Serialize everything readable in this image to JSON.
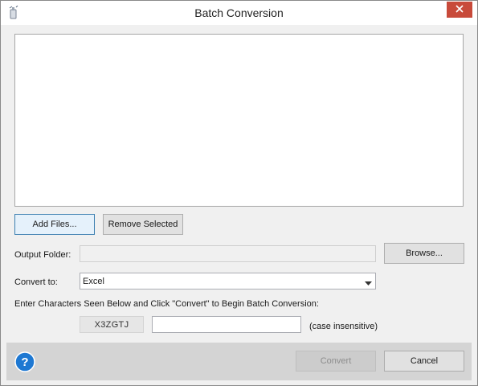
{
  "window": {
    "title": "Batch Conversion",
    "close_glyph": "✕"
  },
  "file_list": {
    "items": []
  },
  "buttons": {
    "add_files": "Add Files...",
    "remove_selected": "Remove Selected",
    "browse": "Browse...",
    "convert": "Convert",
    "cancel": "Cancel"
  },
  "output_folder": {
    "label": "Output Folder:",
    "value": ""
  },
  "convert_to": {
    "label": "Convert to:",
    "selected": "Excel"
  },
  "captcha": {
    "instruction": "Enter Characters Seen Below and Click \"Convert\" to Begin Batch Conversion:",
    "code": "X3ZGTJ",
    "input_value": "",
    "hint": "(case insensitive)"
  },
  "icons": {
    "app": "app-icon",
    "close": "close-icon",
    "dropdown": "chevron-down-icon",
    "help": "help-icon"
  },
  "colors": {
    "close_button": "#c84a3a",
    "help_icon": "#1e78d2",
    "footer": "#d4d4d4",
    "focused_border": "#3c7fb1"
  }
}
